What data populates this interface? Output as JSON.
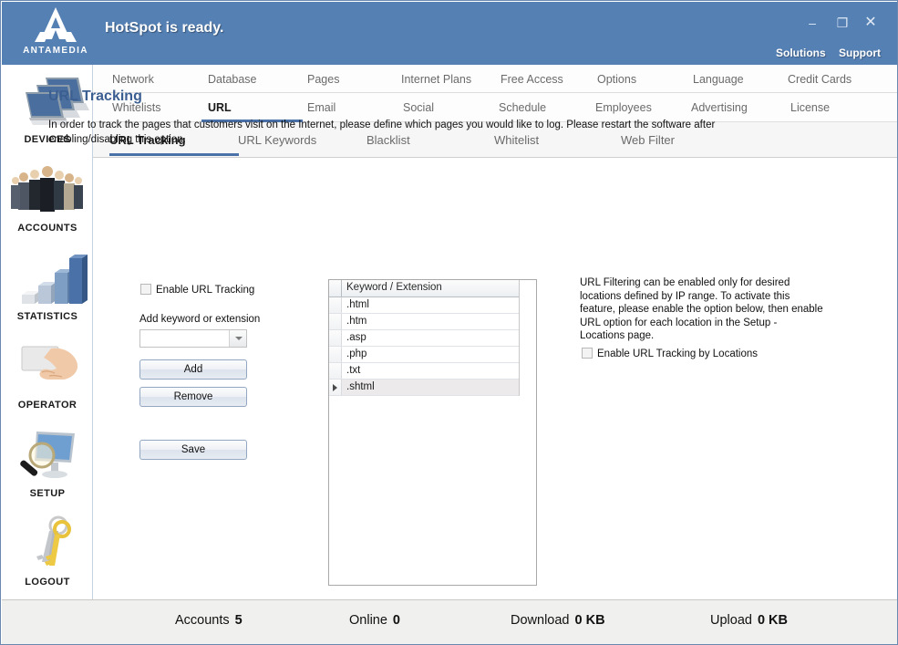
{
  "window": {
    "title": "HotSpot is ready.",
    "brand": "ANTAMEDIA",
    "controls": {
      "minimize": "–",
      "maximize": "❐",
      "close": "✕"
    },
    "links": {
      "solutions": "Solutions",
      "support": "Support"
    },
    "accent_blue": "#5580b4",
    "tab_underline": "#4a72a8",
    "heading_color": "#3c5f92"
  },
  "sidebar": {
    "items": [
      {
        "label": "DEVICES",
        "icon": "laptops-icon"
      },
      {
        "label": "ACCOUNTS",
        "icon": "people-icon"
      },
      {
        "label": "STATISTICS",
        "icon": "bar-chart-icon"
      },
      {
        "label": "OPERATOR",
        "icon": "hand-card-icon"
      },
      {
        "label": "SETUP",
        "icon": "monitor-magnifier-icon"
      },
      {
        "label": "LOGOUT",
        "icon": "keys-icon"
      }
    ]
  },
  "tabs": {
    "row1": [
      {
        "label": "Network",
        "active": false
      },
      {
        "label": "Database",
        "active": false
      },
      {
        "label": "Pages",
        "active": false
      },
      {
        "label": "Internet Plans",
        "active": false
      },
      {
        "label": "Free Access",
        "active": false
      },
      {
        "label": "Options",
        "active": false
      },
      {
        "label": "Language",
        "active": false
      },
      {
        "label": "Credit Cards",
        "active": false
      }
    ],
    "row2": [
      {
        "label": "Whitelists",
        "active": false
      },
      {
        "label": "URL",
        "active": true
      },
      {
        "label": "Email",
        "active": false
      },
      {
        "label": "Social",
        "active": false
      },
      {
        "label": "Schedule",
        "active": false
      },
      {
        "label": "Employees",
        "active": false
      },
      {
        "label": "Advertising",
        "active": false
      },
      {
        "label": "License",
        "active": false
      }
    ],
    "row3": [
      {
        "label": "URL Tracking",
        "active": true
      },
      {
        "label": "URL Keywords",
        "active": false
      },
      {
        "label": "Blacklist",
        "active": false
      },
      {
        "label": "Whitelist",
        "active": false
      },
      {
        "label": "Web Filter",
        "active": false
      }
    ]
  },
  "page": {
    "heading": "URL Tracking",
    "description": "In order to track the pages that customers visit on the Internet, please define which pages you would like to log.  Please restart the software after enabling/disabling this option.",
    "enable_tracking_label": "Enable URL Tracking",
    "add_keyword_label": "Add keyword or extension",
    "combo_value": "",
    "combo_placeholder": "",
    "buttons": {
      "add": "Add",
      "remove": "Remove",
      "save": "Save"
    },
    "info_text": "URL Filtering can be enabled only for desired locations defined by IP range.  To activate this feature, please enable the option below, then enable URL option for each location in the Setup - Locations page.",
    "enable_by_locations_label": "Enable URL Tracking by Locations"
  },
  "grid": {
    "column_header": "Keyword / Extension",
    "rows": [
      {
        "value": ".html",
        "selected": false,
        "current": false
      },
      {
        "value": ".htm",
        "selected": false,
        "current": false
      },
      {
        "value": ".asp",
        "selected": false,
        "current": false
      },
      {
        "value": ".php",
        "selected": false,
        "current": false
      },
      {
        "value": ".txt",
        "selected": false,
        "current": false
      },
      {
        "value": ".shtml",
        "selected": true,
        "current": true
      }
    ]
  },
  "status": {
    "accounts_label": "Accounts",
    "accounts_value": "5",
    "online_label": "Online",
    "online_value": "0",
    "download_label": "Download",
    "download_value": "0 KB",
    "upload_label": "Upload",
    "upload_value": "0 KB"
  }
}
